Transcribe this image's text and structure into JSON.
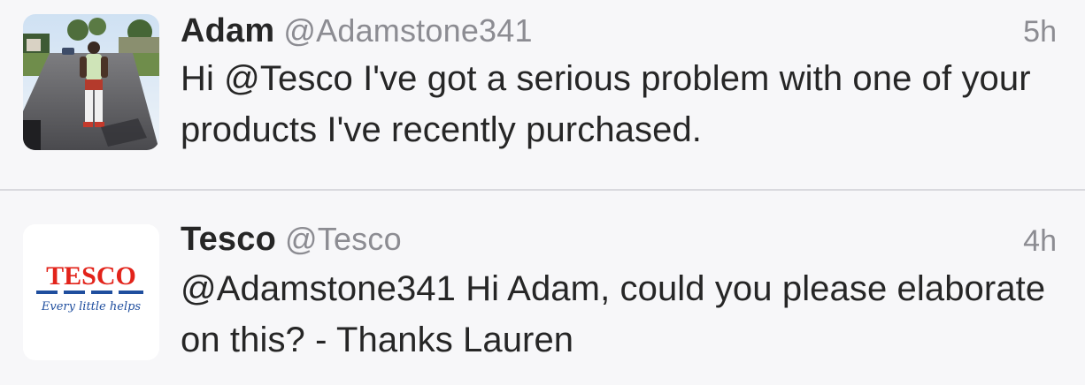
{
  "tweets": [
    {
      "name": "Adam",
      "handle": "@Adamstone341",
      "time": "5h",
      "text": "Hi @Tesco I've got a serious problem with one of your products I've recently purchased."
    },
    {
      "name": "Tesco",
      "handle": "@Tesco",
      "time": "4h",
      "text": "@Adamstone341 Hi Adam, could you please elaborate on this? - Thanks Lauren",
      "avatar_logo": {
        "wordmark": "TESCO",
        "tagline": "Every little helps"
      }
    }
  ],
  "colors": {
    "background": "#f7f7f9",
    "text": "#262626",
    "muted": "#8c8c92",
    "tesco_red": "#e2231a",
    "tesco_blue": "#1f4e9e"
  }
}
